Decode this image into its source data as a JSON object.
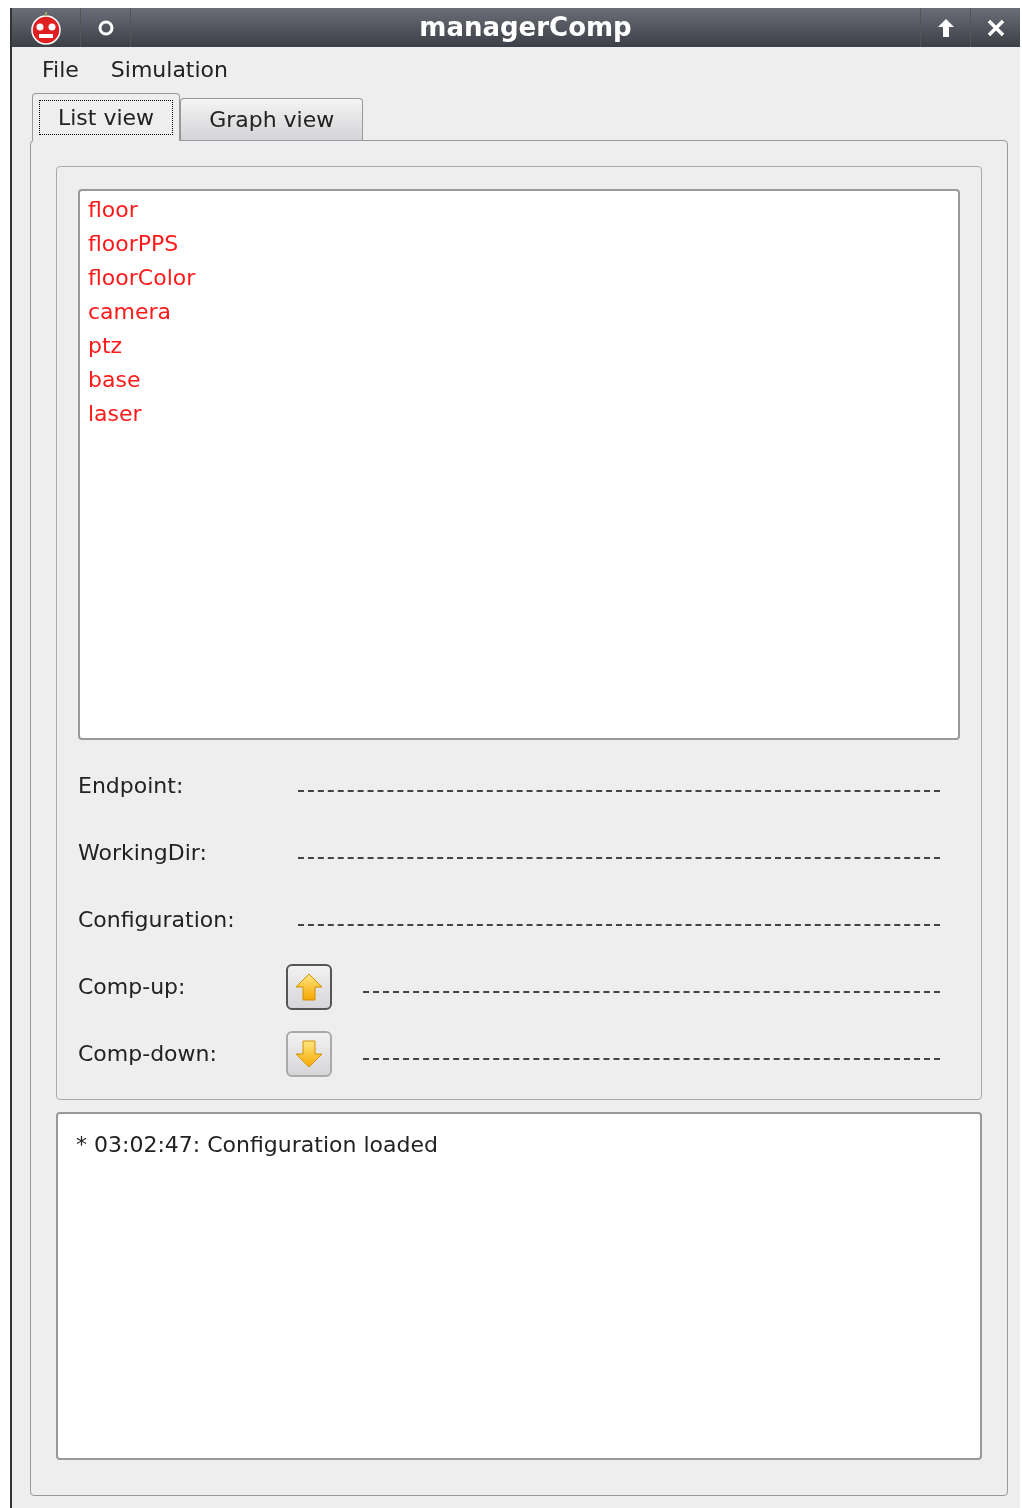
{
  "window": {
    "title": "managerComp"
  },
  "menu": [
    "File",
    "Simulation"
  ],
  "tabs": [
    {
      "label": "List view",
      "selected": true
    },
    {
      "label": "Graph view",
      "selected": false
    }
  ],
  "components": [
    "floor",
    "floorPPS",
    "floorColor",
    "camera",
    "ptz",
    "base",
    "laser"
  ],
  "fields": [
    {
      "label": "Endpoint:",
      "kind": "text"
    },
    {
      "label": "WorkingDir:",
      "kind": "text"
    },
    {
      "label": "Configuration:",
      "kind": "text"
    },
    {
      "label": "Comp-up:",
      "kind": "up"
    },
    {
      "label": "Comp-down:",
      "kind": "down"
    }
  ],
  "log": [
    "* 03:02:47: Configuration loaded"
  ]
}
